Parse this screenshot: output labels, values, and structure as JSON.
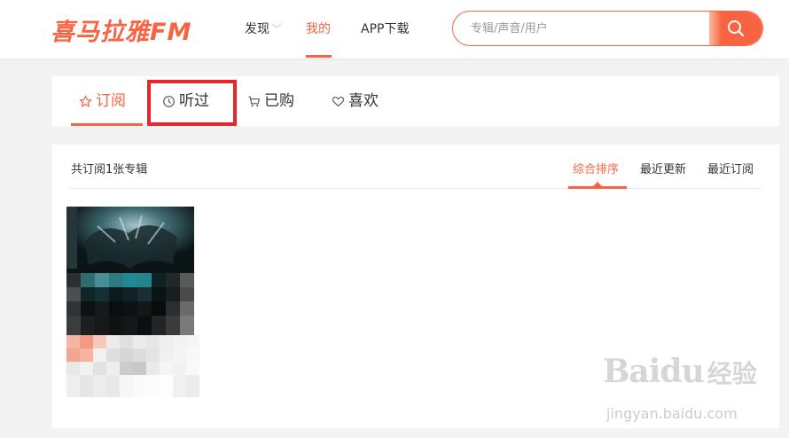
{
  "header": {
    "logo": "喜马拉雅FM",
    "nav": {
      "discover": "发现",
      "mine": "我的",
      "app_download": "APP下载"
    },
    "search": {
      "placeholder": "专辑/声音/用户"
    }
  },
  "tabs": {
    "subscribe": "订阅",
    "history": "听过",
    "bought": "已购",
    "liked": "喜欢"
  },
  "main": {
    "count_text": "共订阅1张专辑",
    "sort": {
      "composite": "综合排序",
      "latest_update": "最近更新",
      "latest_subscribe": "最近订阅"
    }
  },
  "watermark": {
    "brand": "Baidu",
    "brand_cn": "经验",
    "url": "jingyan.baidu.com"
  },
  "colors": {
    "accent": "#f86442",
    "highlight": "#e6262b",
    "background": "#f3f3f3"
  }
}
